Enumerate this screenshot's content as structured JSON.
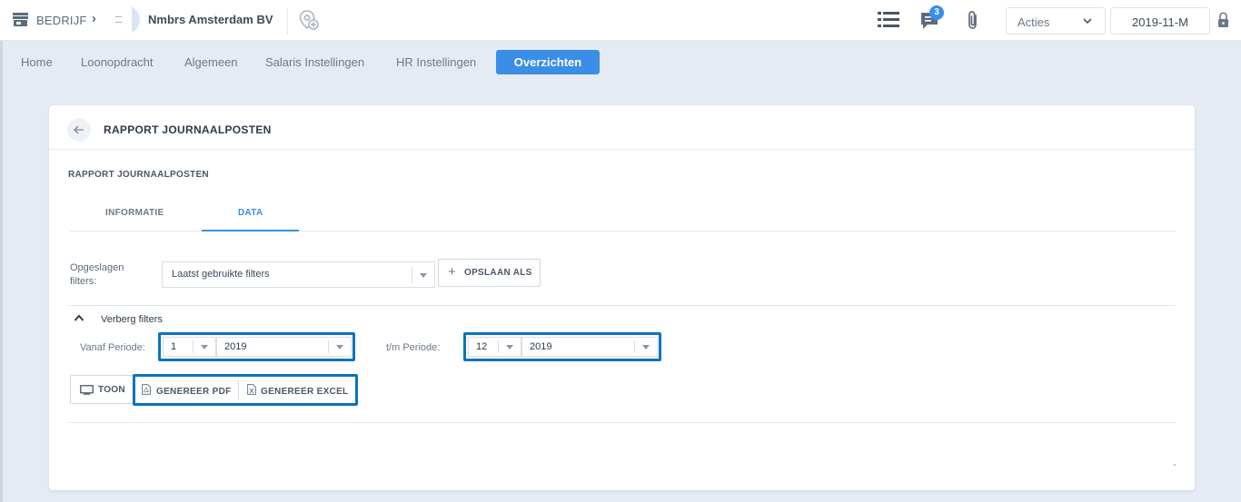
{
  "topbar": {
    "company_label": "BEDRIJF",
    "company_name": "Nmbrs Amsterdam BV",
    "messages_count": "3",
    "actions_label": "Acties",
    "period_value": "2019-11-M"
  },
  "nav": {
    "items": [
      "Home",
      "Loonopdracht",
      "Algemeen",
      "Salaris Instellingen",
      "HR Instellingen",
      "Overzichten"
    ]
  },
  "card": {
    "title": "RAPPORT JOURNAALPOSTEN",
    "subtitle": "RAPPORT JOURNAALPOSTEN",
    "tabs": [
      {
        "label": "INFORMATIE"
      },
      {
        "label": "DATA"
      }
    ],
    "saved_filters": {
      "label": "Opgeslagen filters:",
      "value": "Laatst gebruikte filters",
      "save_as_label": "OPSLAAN ALS"
    },
    "filters_toggle_label": "Verberg filters",
    "from_period": {
      "label": "Vanaf Periode:",
      "period": "1",
      "year": "2019"
    },
    "to_period": {
      "label": "t/m Periode:",
      "period": "12",
      "year": "2019"
    },
    "buttons": {
      "show": "TOON",
      "generate_pdf": "GENEREER PDF",
      "generate_excel": "GENEREER EXCEL"
    }
  },
  "colors": {
    "accent": "#3a8ee6",
    "highlight": "#0b74bb",
    "background": "#e6ebf3"
  }
}
